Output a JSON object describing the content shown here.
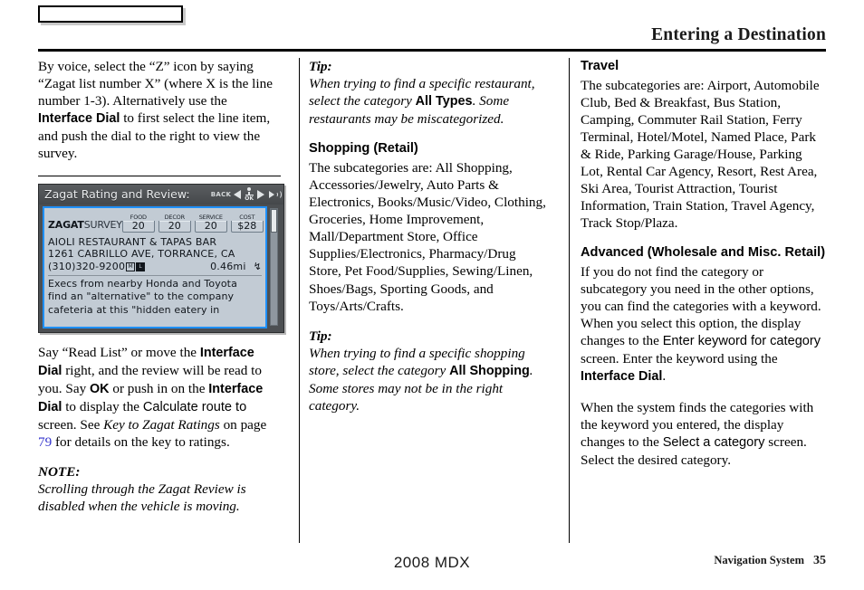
{
  "header": {
    "title": "Entering a Destination",
    "tab_label": ""
  },
  "footer": {
    "model": "2008  MDX",
    "section": "Navigation System",
    "page_number": "35"
  },
  "column1": {
    "intro_part1": "By voice, select the “Z” icon by saying “Zagat list number X” (where X is the line number 1-3). Alternatively use the ",
    "intro_bold1": "Interface Dial",
    "intro_part2": " to first select the line item, and push the dial to the right to view the survey.",
    "after_part1": "Say “Read List” or move the ",
    "after_bold1": "Interface Dial",
    "after_part2": " right, and the review will be read to you. Say ",
    "after_bold2": "OK",
    "after_part3": " or push in on the ",
    "after_bold3": "Interface Dial",
    "after_part4": " to display the ",
    "after_screen": "Calculate route to",
    "after_part5": " screen. See ",
    "after_italic": "Key to Zagat Ratings",
    "after_part6": " on page ",
    "after_xref": "79",
    "after_part7": " for details on the key to ratings.",
    "note_label": "NOTE:",
    "note_text": "Scrolling through the Zagat Review is disabled when the vehicle is moving."
  },
  "nav_screen": {
    "title": "Zagat Rating and Review:",
    "back_label": "BACK",
    "ok_label": "OK",
    "left_arrow_icon": "left-arrow-icon",
    "right_arrow_icon": "right-arrow-icon",
    "speaker_icon": "speaker-icon",
    "brand_bold": "ZAGAT",
    "brand_light": "SURVEY",
    "ratings": [
      {
        "label": "FOOD",
        "value": "20"
      },
      {
        "label": "DECOR",
        "value": "20"
      },
      {
        "label": "SERVICE",
        "value": "20"
      },
      {
        "label": "COST",
        "value": "$28"
      }
    ],
    "poi_name": "AIOLI RESTAURANT & TAPAS BAR",
    "poi_address": "1261 CABRILLO AVE, TORRANCE, CA",
    "poi_phone": "(310)320-9200",
    "badge_1": "M",
    "badge_2": "L",
    "poi_distance": "0.46mi",
    "direction_icon": "compass-arrow-icon",
    "review_line1": "Execs from nearby Honda and Toyota",
    "review_line2": "find an \"alternative\" to the company",
    "review_line3": "cafeteria at this \"hidden eatery in",
    "accent_color": "#1e90ff",
    "panel_color": "#c2cbd4",
    "titlebar_color": "#4c4f52"
  },
  "column2": {
    "tip1_label": "Tip:",
    "tip1_part1": "When trying to find a specific restaurant, select the category ",
    "tip1_bold": "All Types",
    "tip1_part2": ". Some restaurants may be miscategorized.",
    "shopping_heading": "Shopping (Retail)",
    "shopping_body": "The subcategories are: All Shopping, Accessories/Jewelry, Auto Parts & Electronics, Books/Music/Video, Clothing, Groceries, Home Improvement, Mall/Department Store, Office Supplies/Electronics, Pharmacy/Drug Store, Pet Food/Supplies, Sewing/Linen, Shoes/Bags, Sporting Goods, and Toys/Arts/Crafts.",
    "tip2_label": "Tip:",
    "tip2_part1": "When trying to find a specific shopping store, select the category ",
    "tip2_bold": "All Shopping",
    "tip2_part2": ". Some stores may not be in the right category."
  },
  "column3": {
    "travel_heading": "Travel",
    "travel_body": "The subcategories are: Airport, Automobile Club, Bed & Breakfast, Bus Station, Camping, Commuter Rail Station, Ferry Terminal, Hotel/Motel, Named Place, Park & Ride, Parking Garage/House, Parking Lot, Rental Car Agency, Resort, Rest Area, Ski Area, Tourist Attraction, Tourist Information, Train Station, Travel Agency, Track Stop/Plaza.",
    "advanced_heading": "Advanced (Wholesale and Misc. Retail)",
    "adv_part1": "If you do not find the category or subcategory you need in the other options, you can find the categories with a keyword. When you select this option, the display changes to the ",
    "adv_screen1": "Enter keyword for category",
    "adv_part2": " screen. Enter the keyword using the ",
    "adv_bold1": "Interface Dial",
    "adv_part3": ".",
    "adv2_part1": "When the system finds the categories with the keyword you entered, the display changes to the ",
    "adv2_screen": "Select a category",
    "adv2_part2": " screen. Select the desired category."
  }
}
